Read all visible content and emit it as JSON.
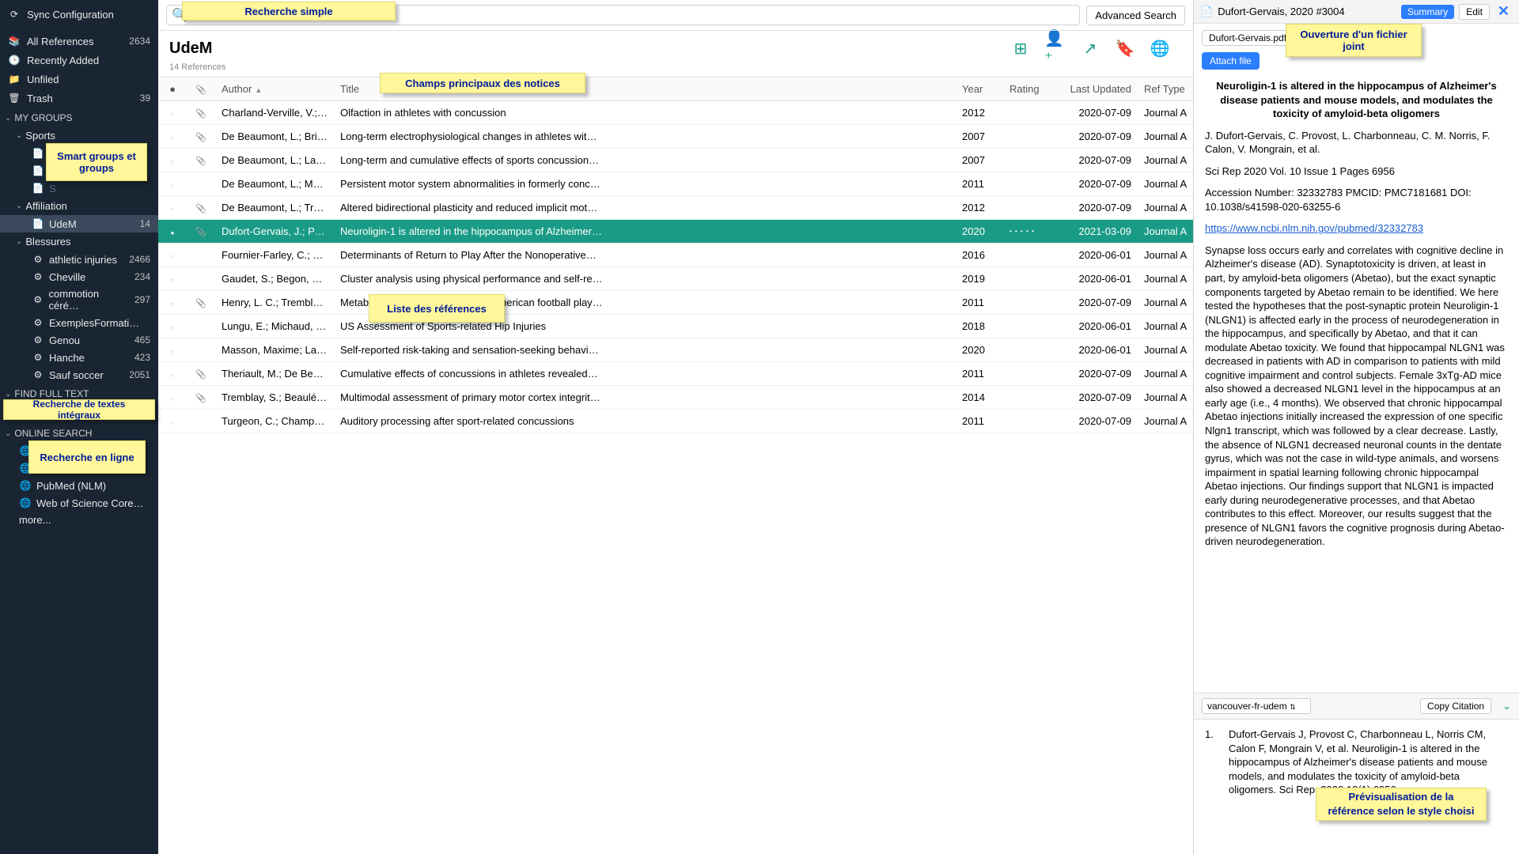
{
  "sidebar": {
    "sync": "Sync Configuration",
    "allRefs": "All References",
    "allRefsCount": "2634",
    "recent": "Recently Added",
    "unfiled": "Unfiled",
    "trash": "Trash",
    "trashCount": "39",
    "myGroups": "MY GROUPS",
    "sports": "Sports",
    "affiliation": "Affiliation",
    "udem": "UdeM",
    "udemCount": "14",
    "blessures": "Blessures",
    "g_athletic": "athletic injuries",
    "g_athletic_c": "2466",
    "g_cheville": "Cheville",
    "g_cheville_c": "234",
    "g_commotion": "commotion céré…",
    "g_commotion_c": "297",
    "g_exemples": "ExemplesFormati…",
    "g_genou": "Genou",
    "g_genou_c": "465",
    "g_hanche": "Hanche",
    "g_hanche_c": "423",
    "g_sauf": "Sauf soccer",
    "g_sauf_c": "2051",
    "findFull": "FIND FULL TEXT",
    "onlineSearch": "ONLINE SEARCH",
    "pubmed": "PubMed (NLM)",
    "wos": "Web of Science Core…",
    "more": "more..."
  },
  "search": {
    "advanced": "Advanced Search"
  },
  "groupHeader": {
    "title": "UdeM",
    "sub": "14 References"
  },
  "cols": {
    "author": "Author",
    "title": "Title",
    "year": "Year",
    "rating": "Rating",
    "updated": "Last Updated",
    "type": "Ref Type"
  },
  "rows": [
    {
      "dot": "e",
      "clip": true,
      "author": "Charland-Verville, V.;…",
      "title": "Olfaction in athletes with concussion",
      "year": "2012",
      "rating": "",
      "updated": "2020-07-09",
      "type": "Journal A"
    },
    {
      "dot": "e",
      "clip": true,
      "author": "De Beaumont, L.; Bris…",
      "title": "Long-term electrophysiological changes in athletes wit…",
      "year": "2007",
      "rating": "",
      "updated": "2020-07-09",
      "type": "Journal A"
    },
    {
      "dot": "e",
      "clip": true,
      "author": "De Beaumont, L.; Lass…",
      "title": "Long-term and cumulative effects of sports concussion…",
      "year": "2007",
      "rating": "",
      "updated": "2020-07-09",
      "type": "Journal A"
    },
    {
      "dot": "e",
      "clip": false,
      "author": "De Beaumont, L.; Mon…",
      "title": "Persistent motor system abnormalities in formerly conc…",
      "year": "2011",
      "rating": "",
      "updated": "2020-07-09",
      "type": "Journal A"
    },
    {
      "dot": "e",
      "clip": true,
      "author": "De Beaumont, L.; Tre…",
      "title": "Altered bidirectional plasticity and reduced implicit mot…",
      "year": "2012",
      "rating": "",
      "updated": "2020-07-09",
      "type": "Journal A"
    },
    {
      "dot": "f",
      "clip": true,
      "author": "Dufort-Gervais, J.; Pro…",
      "title": "Neuroligin-1 is altered in the hippocampus of Alzheimer…",
      "year": "2020",
      "rating": "• • • • •",
      "updated": "2021-03-09",
      "type": "Journal A",
      "sel": true
    },
    {
      "dot": "e",
      "clip": false,
      "author": "Fournier-Farley, C.; La…",
      "title": "Determinants of Return to Play After the Nonoperative…",
      "year": "2016",
      "rating": "",
      "updated": "2020-06-01",
      "type": "Journal A"
    },
    {
      "dot": "e",
      "clip": false,
      "author": "Gaudet, S.; Begon, M.;…",
      "title": "Cluster analysis using physical performance and self-re…",
      "year": "2019",
      "rating": "",
      "updated": "2020-06-01",
      "type": "Journal A"
    },
    {
      "dot": "e",
      "clip": true,
      "author": "Henry, L. C.; Tremblay,…",
      "title": "Metabolic changes in concussed American football play…",
      "year": "2011",
      "rating": "",
      "updated": "2020-07-09",
      "type": "Journal A"
    },
    {
      "dot": "e",
      "clip": false,
      "author": "Lungu, E.; Michaud, J.…",
      "title": "US Assessment of Sports-related Hip Injuries",
      "year": "2018",
      "rating": "",
      "updated": "2020-06-01",
      "type": "Journal A"
    },
    {
      "dot": "e",
      "clip": false,
      "author": "Masson, Maxime; Lam…",
      "title": "Self-reported risk-taking and sensation-seeking behavi…",
      "year": "2020",
      "rating": "",
      "updated": "2020-06-01",
      "type": "Journal A"
    },
    {
      "dot": "e",
      "clip": true,
      "author": "Theriault, M.; De Beau…",
      "title": "Cumulative effects of concussions in athletes revealed…",
      "year": "2011",
      "rating": "",
      "updated": "2020-07-09",
      "type": "Journal A"
    },
    {
      "dot": "e",
      "clip": true,
      "author": "Tremblay, S.; Beaulé,…",
      "title": "Multimodal assessment of primary motor cortex integrit…",
      "year": "2014",
      "rating": "",
      "updated": "2020-07-09",
      "type": "Journal A"
    },
    {
      "dot": "e",
      "clip": false,
      "author": "Turgeon, C.; Champo…",
      "title": "Auditory processing after sport-related concussions",
      "year": "2011",
      "rating": "",
      "updated": "2020-07-09",
      "type": "Journal A"
    }
  ],
  "rpanel": {
    "header": "Dufort-Gervais, 2020 #3004",
    "summary": "Summary",
    "edit": "Edit",
    "file": "Dufort-Gervais.pdf",
    "attach": "Attach file",
    "title": "Neuroligin-1 is altered in the hippocampus of Alzheimer's disease patients and mouse models, and modulates the toxicity of amyloid-beta oligomers",
    "authors": "J. Dufort-Gervais, C. Provost, L. Charbonneau, C. M. Norris, F. Calon, V. Mongrain, et al.",
    "journal": "Sci Rep 2020 Vol. 10 Issue 1 Pages 6956",
    "acc": "Accession Number: 32332783 PMCID: PMC7181681 DOI: 10.1038/s41598-020-63255-6",
    "link": "https://www.ncbi.nlm.nih.gov/pubmed/32332783",
    "abs": "Synapse loss occurs early and correlates with cognitive decline in Alzheimer's disease (AD). Synaptotoxicity is driven, at least in part, by amyloid-beta oligomers (Abetao), but the exact synaptic components targeted by Abetao remain to be identified. We here tested the hypotheses that the post-synaptic protein Neuroligin-1 (NLGN1) is affected early in the process of neurodegeneration in the hippocampus, and specifically by Abetao, and that it can modulate Abetao toxicity. We found that hippocampal NLGN1 was decreased in patients with AD in comparison to patients with mild cognitive impairment and control subjects. Female 3xTg-AD mice also showed a decreased NLGN1 level in the hippocampus at an early age (i.e., 4 months). We observed that chronic hippocampal Abetao injections initially increased the expression of one specific Nlgn1 transcript, which was followed by a clear decrease. Lastly, the absence of NLGN1 decreased neuronal counts in the dentate gyrus, which was not the case in wild-type animals, and worsens impairment in spatial learning following chronic hippocampal Abetao injections. Our findings support that NLGN1 is impacted early during neurodegenerative processes, and that Abetao contributes to this effect. Moreover, our results suggest that the presence of NLGN1 favors the cognitive prognosis during Abetao-driven neurodegeneration.",
    "style": "vancouver-fr-udem",
    "copy": "Copy Citation",
    "citeNum": "1.",
    "cite": "Dufort-Gervais J, Provost C, Charbonneau L, Norris CM, Calon F, Mongrain V, et al. Neuroligin-1 is altered in the hippocampus of Alzheimer's disease patients and mouse models, and modulates the toxicity of amyloid-beta oligomers. Sci Rep. 2020;10(1):6956."
  },
  "callouts": {
    "search": "Recherche simple",
    "fields": "Champs principaux des notices",
    "groups": "Smart groups et groups",
    "list": "Liste des références",
    "fulltext": "Recherche de textes intégraux",
    "online": "Recherche en ligne",
    "attach": "Ouverture d'un fichier joint",
    "cite": "Prévisualisation de la référence selon le style choisi"
  }
}
